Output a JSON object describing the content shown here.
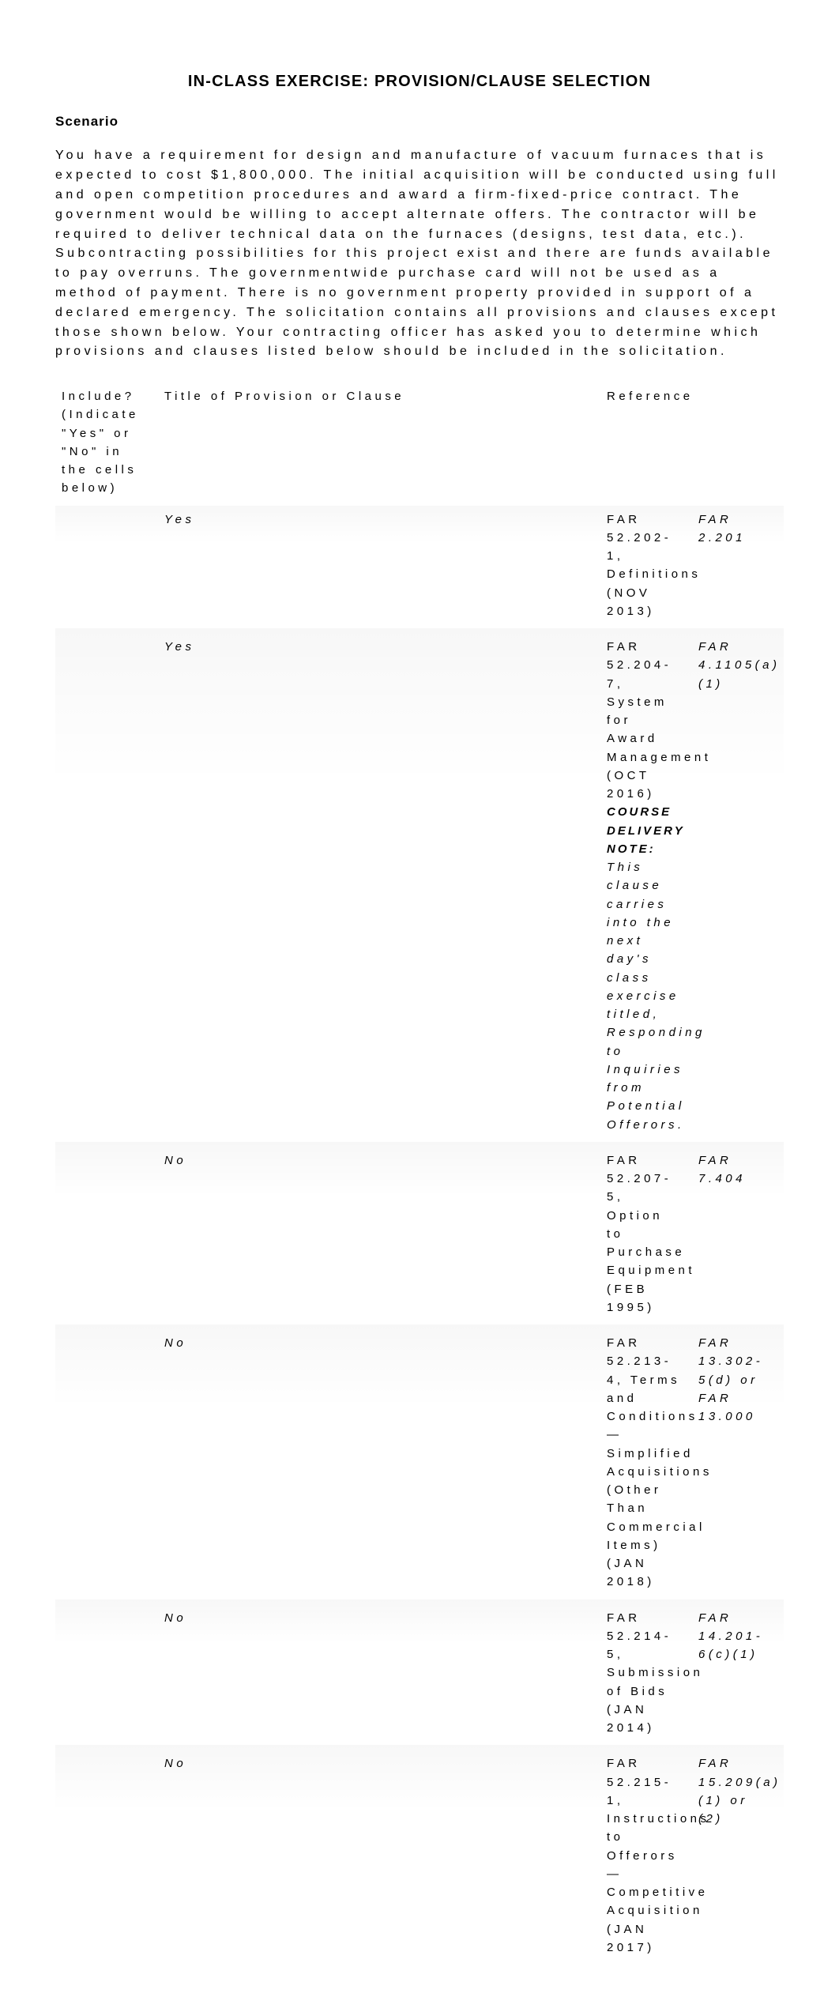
{
  "title": "IN-CLASS EXERCISE: PROVISION/CLAUSE SELECTION",
  "scenario_label": "Scenario",
  "scenario_body": "You have a requirement for design and manufacture of vacuum furnaces that is expected to cost $1,800,000. The initial acquisition will be conducted using full and open competition procedures and award a firm-fixed-price contract. The government would be willing to accept alternate offers. The contractor will be required to deliver technical data on the furnaces (designs, test data, etc.). Subcontracting possibilities for this project exist and there are funds available to pay overruns. The governmentwide purchase card will not be used as a method of payment. There is no government property provided in support of a declared emergency. The solicitation contains all provisions and clauses except those shown below. Your contracting officer has asked you to determine which provisions and clauses listed below should be included in the solicitation.",
  "table": {
    "headers": {
      "include": "Include? (Indicate \"Yes\" or \"No\" in the cells below)",
      "title": "Title of Provision or Clause",
      "ref": "Reference"
    },
    "rows": [
      {
        "yn": "Yes",
        "title": "FAR 52.202-1, Definitions (NOV 2013)",
        "ref": "FAR 2.201"
      },
      {
        "yn": "Yes",
        "title": "FAR 52.204-7, System for Award Management (OCT 2016)",
        "title_note_lead": "COURSE DELIVERY NOTE:",
        "title_note_rest": " This clause carries into the next day's class exercise titled, Responding to Inquiries from Potential Offerors.",
        "ref": "FAR 4.1105(a)(1)"
      },
      {
        "yn": "No",
        "title": "FAR 52.207-5, Option to Purchase Equipment (FEB 1995)",
        "ref": "FAR 7.404"
      },
      {
        "yn": "No",
        "title": "FAR 52.213-4, Terms and Conditions—Simplified Acquisitions (Other Than Commercial Items) (JAN 2018)",
        "ref": "FAR 13.302-5(d) or FAR 13.000"
      },
      {
        "yn": "No",
        "title": "FAR 52.214-5, Submission of Bids (JAN 2014)",
        "ref": "FAR 14.201-6(c)(1)"
      },
      {
        "yn": "No",
        "title": "FAR 52.215-1, Instructions to Offerors — Competitive Acquisition (JAN 2017)",
        "ref": "FAR 15.209(a)(1) or (2)"
      }
    ]
  }
}
